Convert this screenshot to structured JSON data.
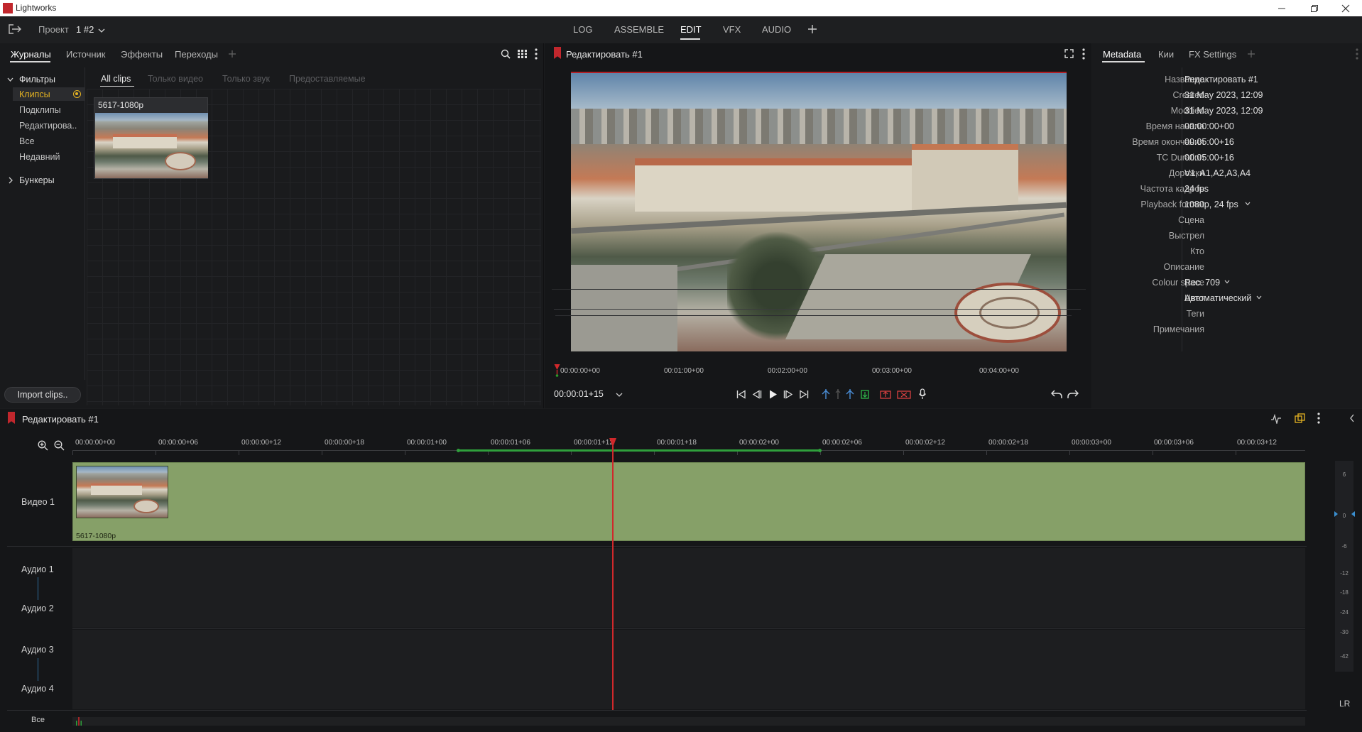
{
  "app": {
    "title": "Lightworks"
  },
  "topbar": {
    "project_label": "Проект",
    "project_value": "1 #2",
    "modes": [
      "LOG",
      "ASSEMBLE",
      "EDIT",
      "VFX",
      "AUDIO"
    ],
    "active_mode": "EDIT"
  },
  "library": {
    "tabs": [
      "Журналы",
      "Источник",
      "Эффекты",
      "Переходы"
    ],
    "filters_label": "Фильтры",
    "filter_items": [
      "Клипсы",
      "Подклипы",
      "Редактирова..",
      "Все",
      "Недавний"
    ],
    "bins_label": "Бункеры",
    "clip_tabs": [
      "All clips",
      "Только видео",
      "Только звук",
      "Предоставляемые"
    ],
    "clip_name": "5617-1080p",
    "import_button": "Import clips.."
  },
  "viewer": {
    "title": "Редактировать #1",
    "ruler": [
      "00:00:00+00",
      "00:01:00+00",
      "00:02:00+00",
      "00:03:00+00",
      "00:04:00+00"
    ],
    "timecode": "00:00:01+15"
  },
  "metadata": {
    "tabs": [
      "Metadata",
      "Кии",
      "FX Settings"
    ],
    "fields": [
      {
        "key": "Название",
        "value": "Редактировать #1"
      },
      {
        "key": "Created",
        "value": "31 May 2023, 12:09"
      },
      {
        "key": "Modified",
        "value": "31 May 2023, 12:09"
      },
      {
        "key": "Время начала",
        "value": "00:00:00+00"
      },
      {
        "key": "Время окончания",
        "value": "00:05:00+16"
      },
      {
        "key": "TC Duration",
        "value": "00:05:00+16"
      },
      {
        "key": "Дорожки",
        "value": "V1, A1,A2,A3,A4"
      },
      {
        "key": "Частота кадров",
        "value": "24 fps"
      },
      {
        "key": "Playback format",
        "value": "1080p, 24 fps"
      },
      {
        "key": "Сцена",
        "value": ""
      },
      {
        "key": "Выстрел",
        "value": ""
      },
      {
        "key": "Кто",
        "value": ""
      },
      {
        "key": "Описание",
        "value": ""
      },
      {
        "key": "Colour space",
        "value": "Rec. 709"
      },
      {
        "key": "Цвет",
        "value": "Автоматический"
      },
      {
        "key": "Теги",
        "value": ""
      },
      {
        "key": "Примечания",
        "value": ""
      }
    ]
  },
  "timeline": {
    "title": "Редактировать #1",
    "ruler": [
      "00:00:00+00",
      "00:00:00+06",
      "00:00:00+12",
      "00:00:00+18",
      "00:00:01+00",
      "00:00:01+06",
      "00:00:01+12",
      "00:00:01+18",
      "00:00:02+00",
      "00:00:02+06",
      "00:00:02+12",
      "00:00:02+18",
      "00:00:03+00",
      "00:00:03+06",
      "00:00:03+12"
    ],
    "tracks": {
      "video1": "Видео 1",
      "audio1": "Аудио 1",
      "audio2": "Аудио 2",
      "audio3": "Аудио 3",
      "audio4": "Аудио 4"
    },
    "clip_label": "5617-1080p",
    "all_label": "Все",
    "meter_labels": [
      "6",
      "0",
      "-6",
      "-12",
      "-18",
      "-24",
      "-30",
      "-42"
    ],
    "lr_label": "LR"
  },
  "colors": {
    "accent_red": "#c1272d",
    "clip_green": "#86a068",
    "playhead": "#d0282b"
  }
}
